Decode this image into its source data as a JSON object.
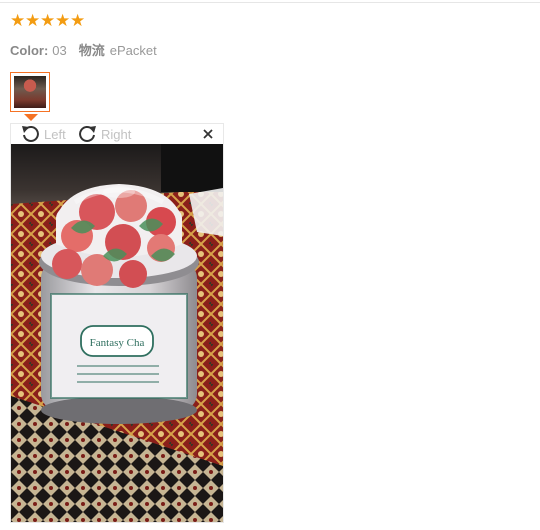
{
  "review": {
    "rating": 5,
    "stars": [
      "★",
      "★",
      "★",
      "★",
      "★"
    ],
    "color_label": "Color:",
    "color_value": "03",
    "shipping_label": "物流",
    "shipping_value": "ePacket"
  },
  "viewer": {
    "rotate_left_label": "Left",
    "rotate_right_label": "Right",
    "icons": {
      "rotate_left": "rotate-left-icon",
      "rotate_right": "rotate-right-icon",
      "close": "close-icon"
    }
  },
  "colors": {
    "star": "#f39c12",
    "thumb_border": "#f57224"
  }
}
